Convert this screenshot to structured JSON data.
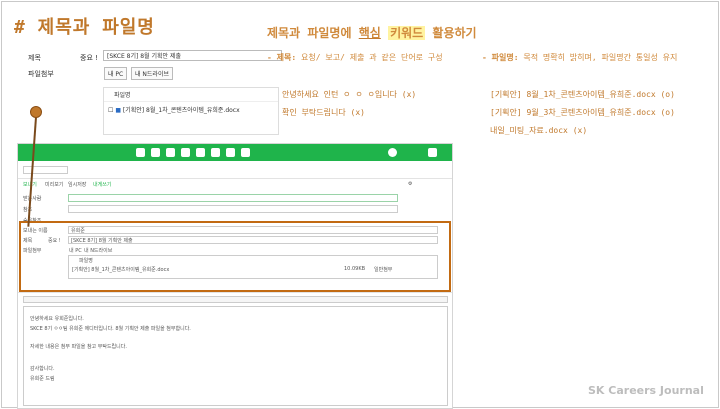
{
  "heading": "# 제목과 파일명",
  "slide_title": {
    "prefix": "제목과 파일명에 ",
    "key": "핵심",
    "key2": "키워드",
    "suffix": " 활용하기"
  },
  "bullets": {
    "title_rule_label": "- 제목:",
    "title_rule_text": "요청/ 보고/ 제출 과 같은 단어로 구성",
    "file_rule_label": "- 파일명:",
    "file_rule_text": "목적 명확히 밝히며, 파일명간 통일성 유지"
  },
  "examples_left": [
    "안녕하세요 인턴 ㅇ ㅇ ㅇ입니다 (x)",
    "확인 부탁드립니다 (x)"
  ],
  "examples_right": [
    "[기획안] 8월_1차_콘텐츠아이템_유희준.docx (o)",
    "[기획안] 9월_3차_콘텐츠아이템_유희준.docx (o)",
    "내일_미팅_자료.docx (x)"
  ],
  "top_form": {
    "label_subject": "제목",
    "label_important": "중요 !",
    "subject_value": "[SKCE 8기] 8월 기획안 제출",
    "label_attach": "파일첨부",
    "chip_pc": "내 PC",
    "chip_drive": "내 N드라이브",
    "file_header": "파일명",
    "file_name": "[기획안] 8월_1차_콘텐츠아이템_유희준.docx"
  },
  "shot": {
    "toolbar_send": "보내기",
    "toolbar_preview": "미리보기",
    "toolbar_temp": "임시저장",
    "toolbar_me": "내게쓰기",
    "label_to": "받는사람",
    "label_cc": "참조",
    "label_bcc": "숨은참조",
    "label_sender": "보내는 이름",
    "sender_value": "유희준",
    "label_subject": "제목",
    "label_important": "중요 !",
    "subject_value": "[SKCE 8기] 8월 기획안 제출",
    "label_attach": "파일첨부",
    "chip_pc": "내 PC",
    "chip_drive": "내 N드라이브",
    "file_header": "파일명",
    "file_name": "[기획안] 8월_1차_콘텐츠아이템_유희준.docx",
    "file_size": "10.09KB",
    "file_type": "일반첨부",
    "body_line1": "안녕하세요 유희준입니다.",
    "body_line2": "SKCE 8기 ㅇㅇ팀 유희준 에디터입니다. 8월 기획안 제출 파일을 첨부합니다.",
    "body_line3": "자세한 내용은 첨부 파일을 참고 부탁드립니다.",
    "body_line4": "감사합니다.",
    "body_line5": "유희준 드림"
  },
  "watermark": "SK Careers Journal"
}
